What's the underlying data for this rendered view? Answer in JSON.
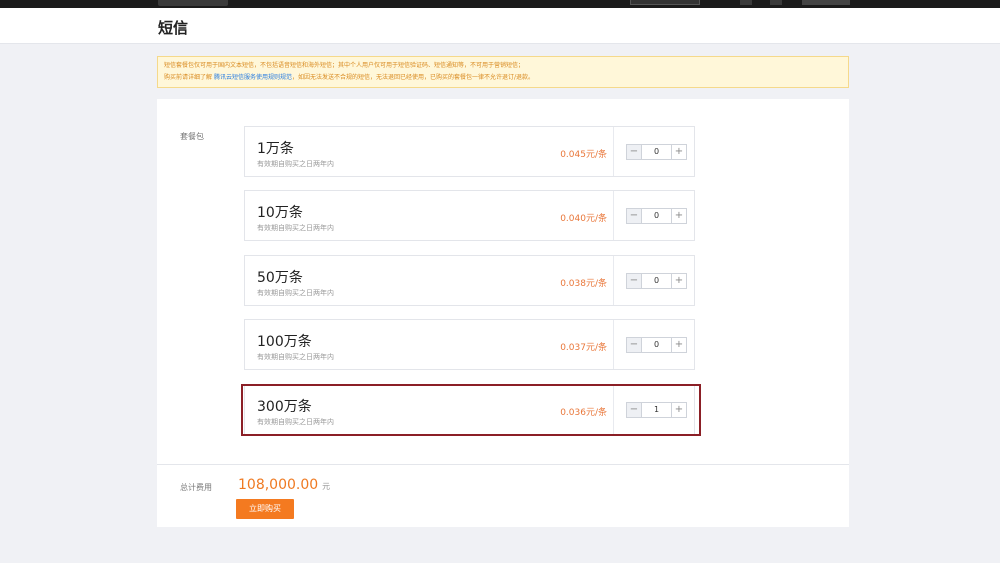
{
  "header": {
    "title": "短信"
  },
  "notice": {
    "line1": "短信套餐包仅可用于国内文本短信，不包括语音短信和海外短信；其中个人用户仅可用于短信验证码、短信通知等，不可用于营销短信；",
    "line2_prefix": "购买前请详细了解",
    "link": "腾讯云短信服务使用规则规范",
    "line2_suffix": "，如因无法发送不合规的短信，无法退回已经使用，已购买的套餐包一律不允许退订/退款。"
  },
  "packages": {
    "label": "套餐包",
    "items": [
      {
        "name": "1万条",
        "validity": "有效期自购买之日两年内",
        "price": "0.045元/条",
        "qty": "0",
        "minus": "−",
        "plus": "+"
      },
      {
        "name": "10万条",
        "validity": "有效期自购买之日两年内",
        "price": "0.040元/条",
        "qty": "0",
        "minus": "−",
        "plus": "+"
      },
      {
        "name": "50万条",
        "validity": "有效期自购买之日两年内",
        "price": "0.038元/条",
        "qty": "0",
        "minus": "−",
        "plus": "+"
      },
      {
        "name": "100万条",
        "validity": "有效期自购买之日两年内",
        "price": "0.037元/条",
        "qty": "0",
        "minus": "−",
        "plus": "+"
      },
      {
        "name": "300万条",
        "validity": "有效期自购买之日两年内",
        "price": "0.036元/条",
        "qty": "1",
        "minus": "−",
        "plus": "+"
      }
    ]
  },
  "total": {
    "label": "总计费用",
    "value": "108,000.00",
    "unit": "元"
  },
  "buy_button": "立即购买",
  "colors": {
    "accent": "#f47a20",
    "price": "#e9773a",
    "highlight": "#8b1f26",
    "notice_bg": "#fff7d9"
  }
}
